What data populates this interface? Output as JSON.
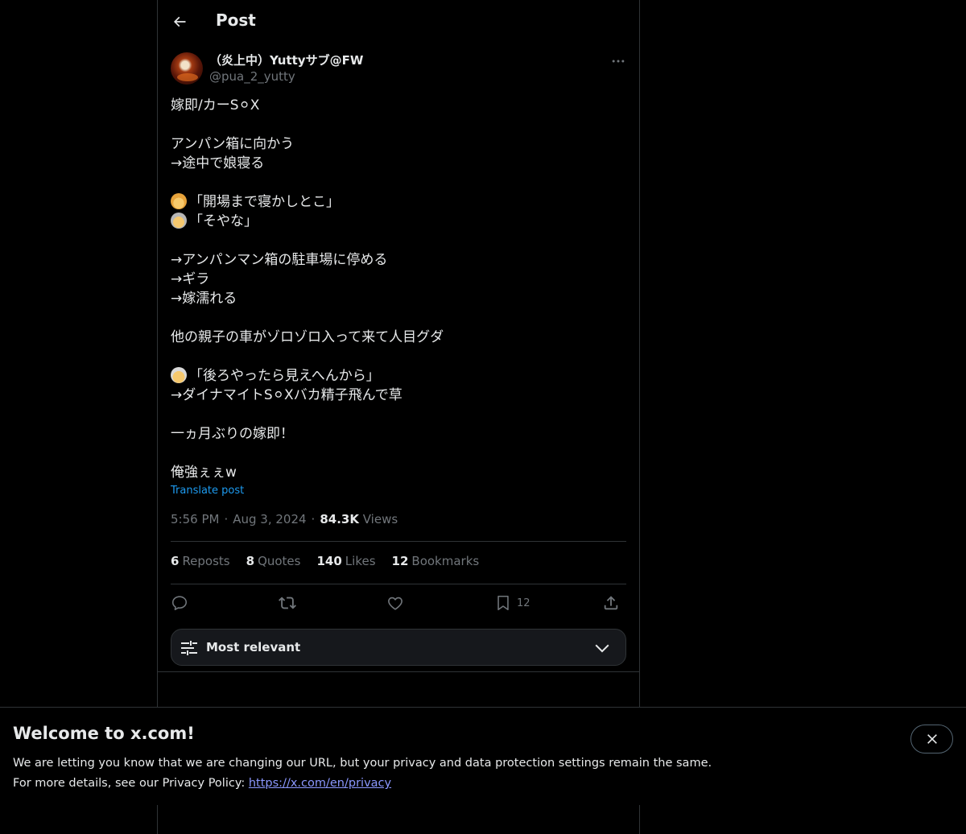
{
  "header": {
    "title": "Post"
  },
  "author": {
    "name": "（炎上中）Yuttyサブ@FW",
    "handle": "@pua_2_yutty"
  },
  "post": {
    "lines": [
      "嫁即/カーS⚪︎X",
      "",
      "アンパン箱に向かう",
      "→途中で娘寝る",
      "",
      "「開場まで寝かしとこ」",
      "「そやな」",
      "",
      "→アンパンマン箱の駐車場に停める",
      "→ギラ",
      "→嫁濡れる",
      "",
      "他の親子の車がゾロゾロ入って来て人目グダ",
      "",
      "「後ろやったら見えへんから」",
      "→ダイナマイトS⚪︎Xバカ精子飛んで草",
      "",
      "一ヵ月ぶりの嫁即！",
      "",
      "俺強ぇぇw"
    ],
    "emoji_prefix": {
      "5": "woman-emoji",
      "6": "man-emoji",
      "14": "man-emoji"
    },
    "translate_label": "Translate post",
    "time": "5:56 PM",
    "date": "Aug 3, 2024",
    "views_count": "84.3K",
    "views_label": "Views"
  },
  "stats": {
    "reposts": {
      "count": "6",
      "label": "Reposts"
    },
    "quotes": {
      "count": "8",
      "label": "Quotes"
    },
    "likes": {
      "count": "140",
      "label": "Likes"
    },
    "bookmarks": {
      "count": "12",
      "label": "Bookmarks"
    }
  },
  "actions": {
    "bookmark_count": "12"
  },
  "sort": {
    "label": "Most relevant"
  },
  "banner": {
    "title": "Welcome to x.com!",
    "line1": "We are letting you know that we are changing our URL, but your privacy and data protection settings remain the same.",
    "line2_prefix": "For more details, see our Privacy Policy: ",
    "link": "https://x.com/en/privacy"
  },
  "colors": {
    "background": "#000000",
    "text": "#e7e9ea",
    "muted": "#71767b",
    "accent": "#1d9bf0",
    "border": "#2f3336",
    "link": "#8b98ff"
  }
}
